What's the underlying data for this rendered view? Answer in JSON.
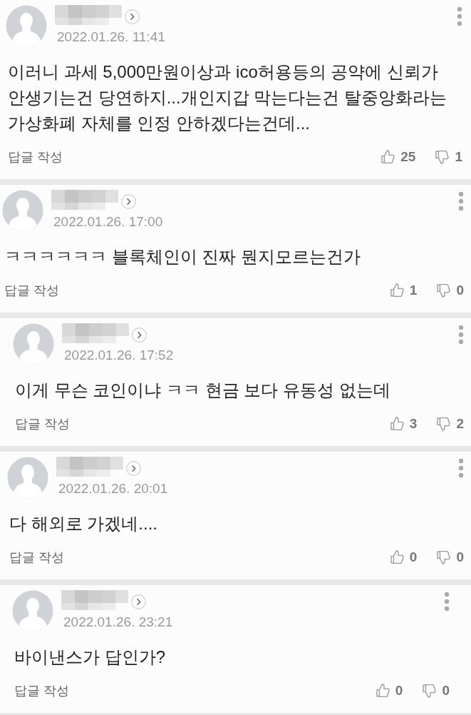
{
  "comments": [
    {
      "date": "2022.01.26. 11:41",
      "text": "이러니 과세 5,000만원이상과 ico허용등의 공약에 신뢰가 안생기는건 당연하지...개인지갑 막는다는건 탈중앙화라는 가상화폐 자체를 인정 안하겠다는건데...",
      "reply_label": "답글 작성",
      "likes": "25",
      "dislikes": "1"
    },
    {
      "date": "2022.01.26. 17:00",
      "text": "ㅋㅋㅋㅋㅋㅋ 블록체인이 진짜 뭔지모르는건가",
      "reply_label": "답글 작성",
      "likes": "1",
      "dislikes": "0"
    },
    {
      "date": "2022.01.26. 17:52",
      "text": "이게 무슨 코인이냐 ㅋㅋ 현금 보다 유동성 없는데",
      "reply_label": "답글 작성",
      "likes": "3",
      "dislikes": "2"
    },
    {
      "date": "2022.01.26. 20:01",
      "text": "다 해외로 가겠네....",
      "reply_label": "답글 작성",
      "likes": "0",
      "dislikes": "0"
    },
    {
      "date": "2022.01.26. 23:21",
      "text": "바이낸스가 답인가?",
      "reply_label": "답글 작성",
      "likes": "0",
      "dislikes": "0"
    }
  ]
}
